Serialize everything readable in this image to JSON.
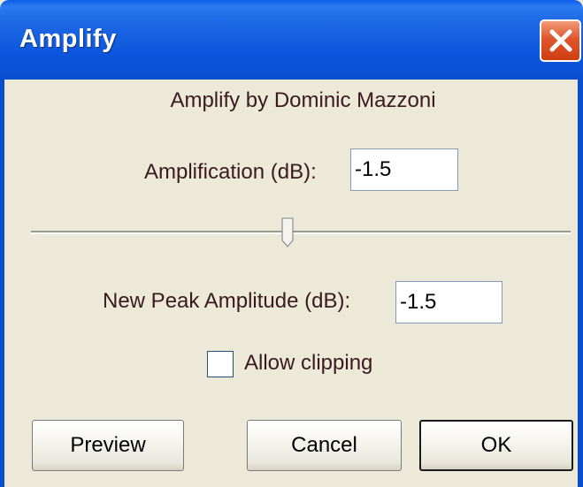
{
  "window": {
    "title": "Amplify"
  },
  "dialog": {
    "heading": "Amplify by Dominic Mazzoni",
    "amplification": {
      "label": "Amplification (dB):",
      "value": "-1.5"
    },
    "slider": {
      "level": 0.48
    },
    "peak": {
      "label": "New Peak Amplitude (dB):",
      "value": "-1.5"
    },
    "clipping": {
      "label": "Allow clipping",
      "checked": false
    }
  },
  "buttons": {
    "preview": "Preview",
    "cancel": "Cancel",
    "ok": "OK"
  },
  "colors": {
    "titlebar": "#0a55dc",
    "dialog_bg": "#ece9d8",
    "close_button": "#e0562c",
    "text": "#3a1a1a"
  }
}
